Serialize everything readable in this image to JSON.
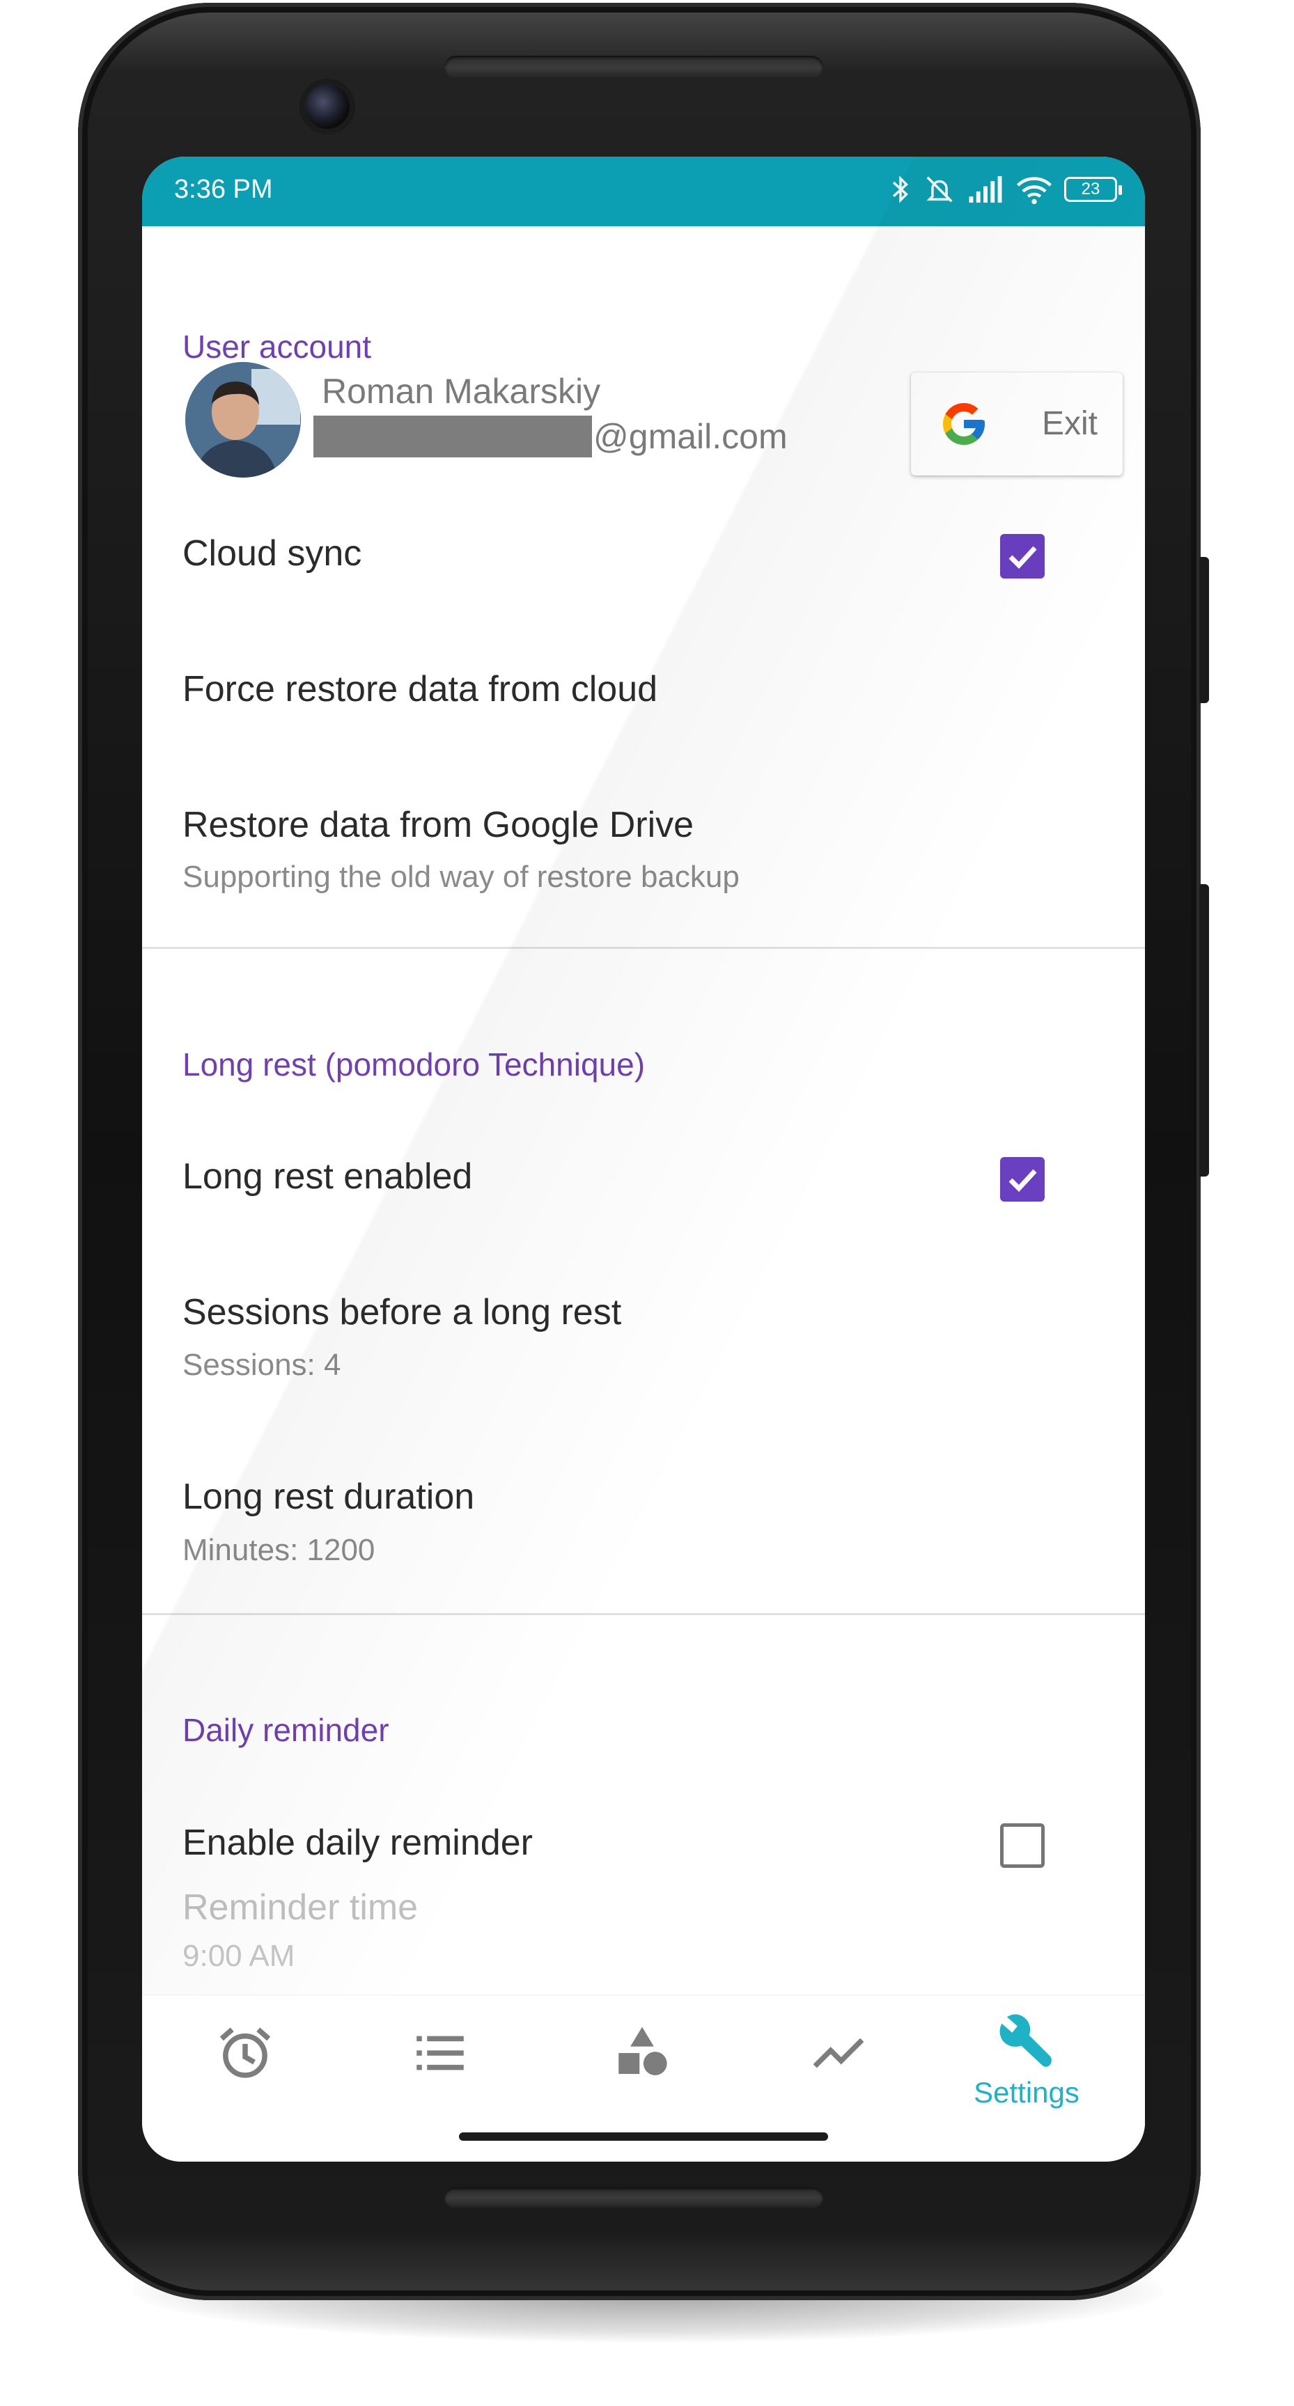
{
  "status_bar": {
    "time": "3:36 PM",
    "battery": "23",
    "icons": [
      "bluetooth-icon",
      "alarm-off-icon",
      "signal-icon",
      "wifi-icon",
      "battery-icon"
    ]
  },
  "user_account": {
    "section_title": "User account",
    "name": "Roman Makarskiy",
    "email_suffix": "@gmail.com",
    "exit_label": "Exit"
  },
  "cloud": {
    "cloud_sync_label": "Cloud sync",
    "cloud_sync_checked": true,
    "force_restore_label": "Force restore data from cloud",
    "restore_drive_label": "Restore data from Google Drive",
    "restore_drive_sub": "Supporting the old way of restore backup"
  },
  "long_rest": {
    "section_title": "Long rest (pomodoro Technique)",
    "enabled_label": "Long rest enabled",
    "enabled_checked": true,
    "sessions_label": "Sessions before a long rest",
    "sessions_sub": "Sessions: 4",
    "duration_label": "Long rest duration",
    "duration_sub": "Minutes: 1200"
  },
  "daily_reminder": {
    "section_title": "Daily reminder",
    "enable_label": "Enable daily reminder",
    "enable_checked": false,
    "time_label": "Reminder time",
    "time_sub": "9:00 AM"
  },
  "bottom_nav": {
    "items": [
      {
        "icon": "alarm-clock-icon",
        "label": ""
      },
      {
        "icon": "list-icon",
        "label": ""
      },
      {
        "icon": "shapes-icon",
        "label": ""
      },
      {
        "icon": "chart-line-icon",
        "label": ""
      },
      {
        "icon": "wrench-icon",
        "label": "Settings",
        "active": true
      }
    ]
  },
  "colors": {
    "status_bar": "#0c9fb3",
    "accent": "#6a3fc0",
    "active_nav": "#1fb2c6"
  }
}
